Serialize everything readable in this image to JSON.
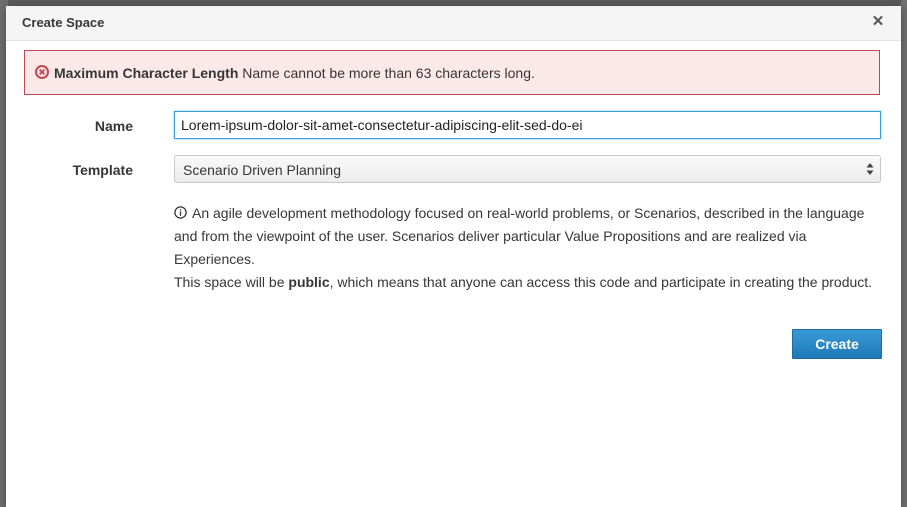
{
  "dialog": {
    "title": "Create Space",
    "close_icon": "close-icon"
  },
  "alert": {
    "icon": "error-circle-icon",
    "title": "Maximum Character Length",
    "message": "Name cannot be more than 63 characters long.",
    "color": "#c0464f"
  },
  "form": {
    "name_label": "Name",
    "name_value": "Lorem-ipsum-dolor-sit-amet-consectetur-adipiscing-elit-sed-do-ei",
    "template_label": "Template",
    "template_selected": "Scenario Driven Planning",
    "help_icon": "info-circle-icon",
    "help_description": "An agile development methodology focused on real-world problems, or Scenarios, described in the language and from the viewpoint of the user. Scenarios deliver particular Value Propositions and are realized via Experiences.",
    "visibility_prefix": "This space will be",
    "visibility_value": "public",
    "visibility_suffix": ", which means that anyone can access this code and participate in creating the product."
  },
  "actions": {
    "create_label": "Create",
    "primary_color": "#2a88c8"
  }
}
